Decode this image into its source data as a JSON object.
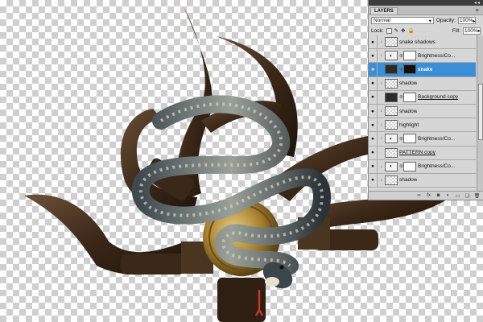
{
  "panel": {
    "title_tab": "LAYERS",
    "collapse_glyph": "◂◂",
    "blend_mode": "Normal",
    "opacity_label": "Opacity:",
    "opacity_value": "100%",
    "fill_label": "Fill:",
    "fill_value": "100%",
    "lock_label": "Lock:"
  },
  "layers": [
    {
      "name": "snake shadows",
      "thumb": "transparent",
      "mask": false,
      "selected": false,
      "underline": false
    },
    {
      "name": "Brightness/Co...",
      "thumb": "adjustment",
      "mask": true,
      "selected": false,
      "underline": false
    },
    {
      "name": "snake",
      "thumb": "dark",
      "mask": "black",
      "selected": true,
      "underline": false
    },
    {
      "name": "shadow",
      "thumb": "transparent",
      "mask": false,
      "selected": false,
      "underline": false
    },
    {
      "name": "Background copy",
      "thumb": "dark",
      "mask": true,
      "selected": false,
      "underline": true
    },
    {
      "name": "shadow",
      "thumb": "transparent",
      "mask": false,
      "selected": false,
      "underline": false
    },
    {
      "name": "highlight",
      "thumb": "transparent",
      "mask": false,
      "selected": false,
      "underline": false
    },
    {
      "name": "Brightness/Co...",
      "thumb": "adjustment",
      "mask": true,
      "selected": false,
      "underline": false
    },
    {
      "name": "PATTERN copy",
      "thumb": "transparent",
      "mask": false,
      "selected": false,
      "underline": true
    },
    {
      "name": "Brightness/Co...",
      "thumb": "adjustment",
      "mask": true,
      "selected": false,
      "underline": false
    },
    {
      "name": "shadow",
      "thumb": "transparent",
      "mask": false,
      "selected": false,
      "underline": false
    }
  ],
  "bottom_icons": [
    "link-layers-icon",
    "fx-icon",
    "add-mask-icon",
    "adjustment-layer-icon",
    "new-group-icon",
    "new-layer-icon",
    "trash-icon"
  ],
  "colors": {
    "selection": "#3a8fd6",
    "panel_bg": "#d6d6d6",
    "horn": "#3d2a1a",
    "brass": "#b08a3a"
  }
}
